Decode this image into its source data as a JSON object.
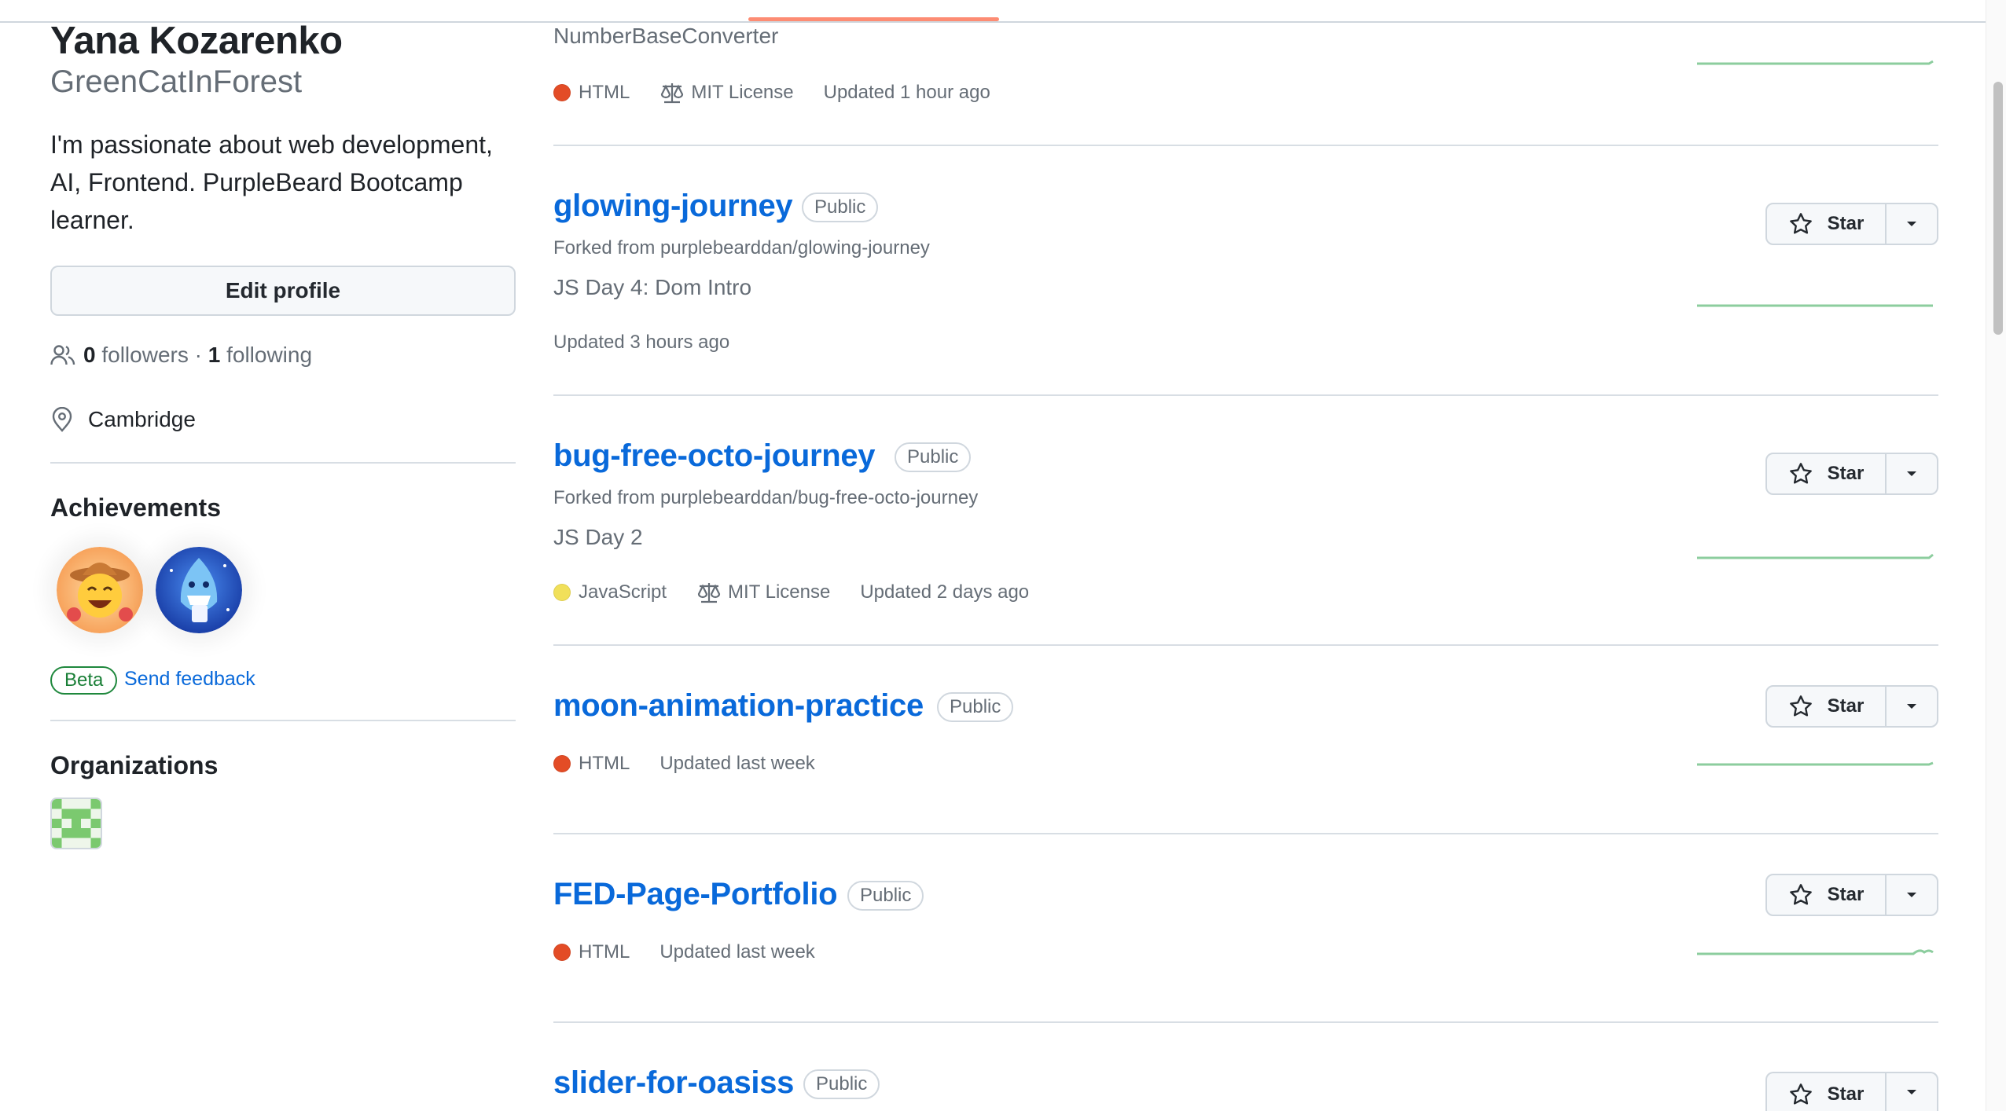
{
  "profile": {
    "fullname": "Yana Kozarenko",
    "username": "GreenCatInForest",
    "bio": "I'm passionate about web development, AI, Frontend. PurpleBeard Bootcamp learner.",
    "edit_label": "Edit profile",
    "followers_count": "0",
    "followers_label": "followers",
    "separator": "·",
    "following_count": "1",
    "following_label": "following",
    "location": "Cambridge"
  },
  "achievements": {
    "title": "Achievements",
    "badges": [
      "cowboy-achievement-badge",
      "shark-achievement-badge"
    ],
    "beta_label": "Beta",
    "feedback_label": "Send feedback"
  },
  "organizations": {
    "title": "Organizations"
  },
  "repos": [
    {
      "name": "",
      "description": "NumberBaseConverter",
      "language": "HTML",
      "language_color": "#e34c26",
      "license": "MIT License",
      "updated": "Updated 1 hour ago"
    },
    {
      "name": "glowing-journey",
      "visibility": "Public",
      "forked_from": "Forked from purplebearddan/glowing-journey",
      "description": "JS Day 4: Dom Intro",
      "updated": "Updated 3 hours ago",
      "star_label": "Star"
    },
    {
      "name": "bug-free-octo-journey",
      "visibility": "Public",
      "forked_from": "Forked from purplebearddan/bug-free-octo-journey",
      "description": "JS Day 2",
      "language": "JavaScript",
      "language_color": "#f1e05a",
      "license": "MIT License",
      "updated": "Updated 2 days ago",
      "star_label": "Star"
    },
    {
      "name": "moon-animation-practice",
      "visibility": "Public",
      "language": "HTML",
      "language_color": "#e34c26",
      "updated": "Updated last week",
      "star_label": "Star"
    },
    {
      "name": "FED-Page-Portfolio",
      "visibility": "Public",
      "language": "HTML",
      "language_color": "#e34c26",
      "updated": "Updated last week",
      "star_label": "Star"
    },
    {
      "name": "slider-for-oasiss",
      "visibility": "Public",
      "star_label": "Star"
    }
  ],
  "colors": {
    "link": "#0969da",
    "accent_underline": "#fd8c73",
    "spark": "#2da44e"
  }
}
